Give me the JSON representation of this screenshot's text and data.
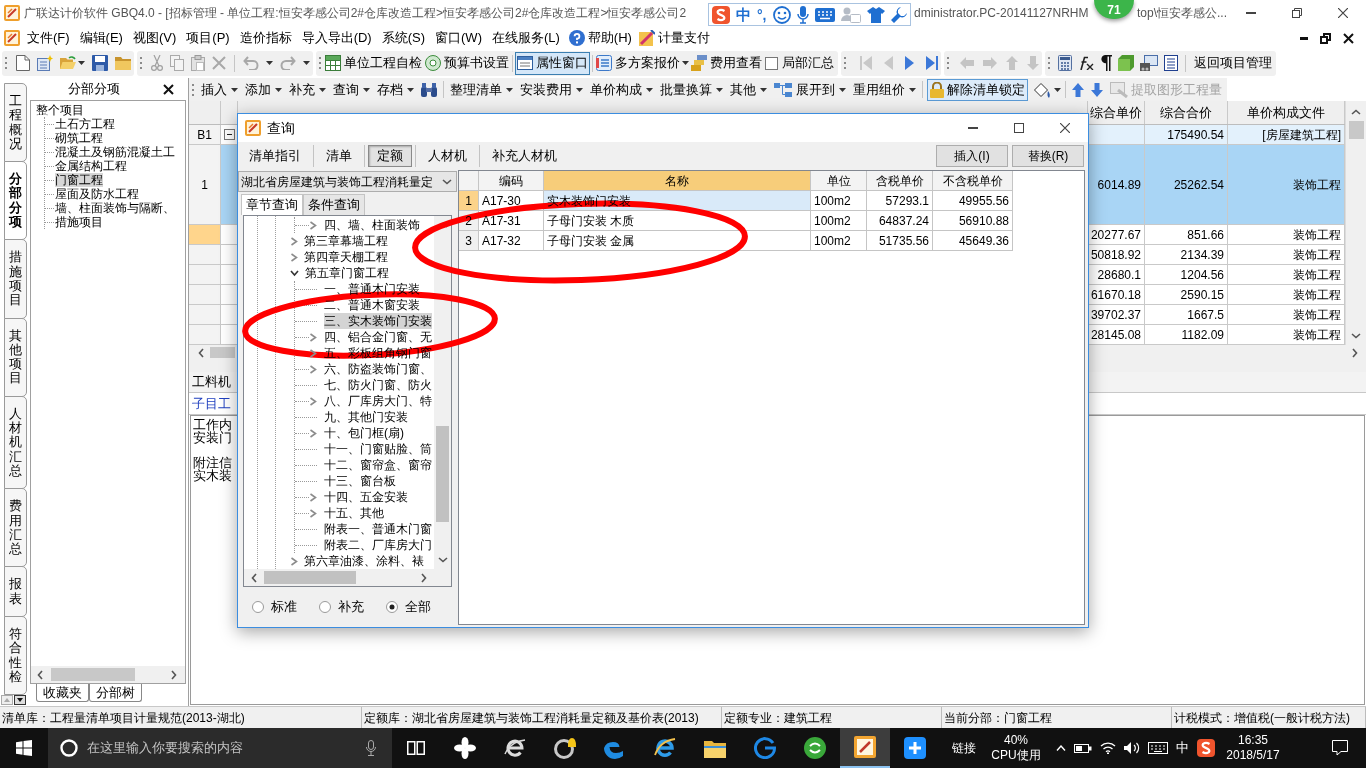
{
  "window": {
    "title": "广联达计价软件 GBQ4.0 - [招标管理 - 单位工程:恒安孝感公司2#仓库改造工程>恒安孝感公司2#仓库改造工程>恒安孝感公司2",
    "title_part_2": "dministrator.PC-20141127NRHM",
    "title_part_3": "top\\恒安孝感公..."
  },
  "ime_toolbar": {
    "mode": "中",
    "punctuation": "°,"
  },
  "floating_ball": {
    "value": "71"
  },
  "menu": {
    "items": [
      "文件(F)",
      "编辑(E)",
      "视图(V)",
      "项目(P)",
      "造价指标",
      "导入导出(D)",
      "系统(S)",
      "窗口(W)",
      "在线服务(L)"
    ],
    "help": "帮助(H)",
    "payment": "计量支付"
  },
  "toolbar": {
    "self_check": "单位工程自检",
    "budget_settings": "预算书设置",
    "property_window": {
      "label": "属性窗口",
      "pressed": true
    },
    "multi_quote": "多方案报价",
    "cost_view": "费用查看",
    "partial_summary": {
      "label": "局部汇总",
      "checked": false
    },
    "return_to_project": "返回项目管理"
  },
  "side_tabs": [
    {
      "label": "工程概况",
      "selected": false
    },
    {
      "label": "分部分项",
      "selected": true
    },
    {
      "label": "措施项目",
      "selected": false
    },
    {
      "label": "其他项目",
      "selected": false
    },
    {
      "label": "人材机汇总",
      "selected": false
    },
    {
      "label": "费用汇总",
      "selected": false
    },
    {
      "label": "报表",
      "selected": false
    },
    {
      "label": "符合性检",
      "selected": false
    }
  ],
  "division_panel": {
    "title": "分部分项",
    "tree": {
      "label": "整个项目",
      "selected": false,
      "children": [
        {
          "label": "土石方工程",
          "selected": false
        },
        {
          "label": "砌筑工程",
          "selected": false
        },
        {
          "label": "混凝土及钢筋混凝土工",
          "selected": false
        },
        {
          "label": "金属结构工程",
          "selected": false
        },
        {
          "label": "门窗工程",
          "selected": true
        },
        {
          "label": "屋面及防水工程",
          "selected": false
        },
        {
          "label": "墙、柱面装饰与隔断、",
          "selected": false
        },
        {
          "label": "措施项目",
          "selected": false
        }
      ]
    },
    "bottom_tabs": [
      "收藏夹",
      "分部树"
    ]
  },
  "edit_toolbar": {
    "menus": [
      {
        "label": "插入",
        "kind": "menu"
      },
      {
        "label": "添加",
        "kind": "menu"
      },
      {
        "label": "补充",
        "kind": "menu"
      },
      {
        "label": "查询",
        "kind": "menu"
      },
      {
        "label": "存档",
        "kind": "menu"
      }
    ],
    "tools": [
      {
        "label": "整理清单",
        "kind": "menu"
      },
      {
        "label": "安装费用",
        "kind": "menu"
      },
      {
        "label": "单价构成",
        "kind": "menu"
      },
      {
        "label": "批量换算",
        "kind": "menu"
      },
      {
        "label": "其他",
        "kind": "menu"
      },
      {
        "label": "展开到",
        "kind": "icon_menu"
      },
      {
        "label": "重用组价",
        "kind": "menu"
      }
    ],
    "unlock": {
      "label": "解除清单锁定",
      "pressed": true
    },
    "extract": {
      "label": "提取图形工程量",
      "disabled": true
    }
  },
  "grid": {
    "columns": [
      "综合单价",
      "综合合价",
      "单价构成文件"
    ],
    "rows": [
      {
        "kind": "section",
        "number": "B1",
        "expanded": true,
        "selected": false,
        "focused": false,
        "total": "175490.54",
        "price_file": "[房屋建筑工程]"
      },
      {
        "kind": "item",
        "number": "1",
        "selected": true,
        "focused": false,
        "unit_price": "6014.89",
        "total": "25262.54",
        "price_file": "装饰工程"
      },
      {
        "kind": "sub",
        "selected": false,
        "focused": true,
        "unit_price": "20277.67",
        "total": "851.66",
        "price_file": "装饰工程"
      },
      {
        "kind": "sub",
        "selected": false,
        "focused": false,
        "unit_price": "50818.92",
        "total": "2134.39",
        "price_file": "装饰工程"
      },
      {
        "kind": "sub",
        "selected": false,
        "focused": false,
        "unit_price": "28680.1",
        "total": "1204.56",
        "price_file": "装饰工程"
      },
      {
        "kind": "sub",
        "selected": false,
        "focused": false,
        "unit_price": "61670.18",
        "total": "2590.15",
        "price_file": "装饰工程"
      },
      {
        "kind": "sub",
        "selected": false,
        "focused": false,
        "unit_price": "39702.37",
        "total": "1667.5",
        "price_file": "装饰工程"
      },
      {
        "kind": "sub",
        "selected": false,
        "focused": false,
        "unit_price": "28145.08",
        "total": "1182.09",
        "price_file": "装饰工程"
      }
    ]
  },
  "lower_panel": {
    "tab": "工料机",
    "subtab": "子目工",
    "sections": [
      {
        "heading": "工作内",
        "text": "安装门"
      },
      {
        "heading": "附注信",
        "text": "实木装"
      }
    ]
  },
  "dialog": {
    "title": "查询",
    "tabs": [
      {
        "label": "清单指引",
        "selected": false
      },
      {
        "label": "清单",
        "selected": false
      },
      {
        "label": "定额",
        "selected": true
      },
      {
        "label": "人材机",
        "selected": false
      },
      {
        "label": "补充人材机",
        "selected": false
      }
    ],
    "buttons": [
      "插入(I)",
      "替换(R)"
    ],
    "library": "湖北省房屋建筑与装饰工程消耗量定",
    "search_tabs": [
      {
        "label": "章节查询",
        "selected": true
      },
      {
        "label": "条件查询",
        "selected": false
      }
    ],
    "tree": [
      {
        "children": [
          {
            "label": "四、墙、柱面装饰",
            "kind": "branch",
            "expanded": false,
            "selected": false
          }
        ]
      },
      {
        "label": "第三章幕墙工程",
        "kind": "branch",
        "expanded": false,
        "selected": false
      },
      {
        "label": "第四章天棚工程",
        "kind": "branch",
        "expanded": false,
        "selected": false
      },
      {
        "label": "第五章门窗工程",
        "kind": "branch",
        "expanded": true,
        "selected": false,
        "children": [
          {
            "label": "一、普通木门安装",
            "kind": "leaf",
            "selected": false
          },
          {
            "label": "二、普通木窗安装",
            "kind": "leaf",
            "selected": false
          },
          {
            "label": "三、实木装饰门安装",
            "kind": "leaf",
            "selected": true
          },
          {
            "label": "四、铝合金门窗、无",
            "kind": "branch",
            "expanded": false,
            "selected": false
          },
          {
            "label": "五、彩板组角钢门窗",
            "kind": "branch",
            "expanded": false,
            "selected": false
          },
          {
            "label": "六、防盗装饰门窗、",
            "kind": "branch",
            "expanded": false,
            "selected": false
          },
          {
            "label": "七、防火门窗、防火",
            "kind": "leaf",
            "selected": false
          },
          {
            "label": "八、厂库房大门、特",
            "kind": "branch",
            "expanded": false,
            "selected": false
          },
          {
            "label": "九、其他门安装",
            "kind": "leaf",
            "selected": false
          },
          {
            "label": "十、包门框(扇)",
            "kind": "branch",
            "expanded": false,
            "selected": false
          },
          {
            "label": "十一、门窗贴脸、筒",
            "kind": "leaf",
            "selected": false
          },
          {
            "label": "十二、窗帘盒、窗帘",
            "kind": "leaf",
            "selected": false
          },
          {
            "label": "十三、窗台板",
            "kind": "leaf",
            "selected": false
          },
          {
            "label": "十四、五金安装",
            "kind": "branch",
            "expanded": false,
            "selected": false
          },
          {
            "label": "十五、其他",
            "kind": "branch",
            "expanded": false,
            "selected": false
          },
          {
            "label": "附表一、普通木门窗",
            "kind": "leaf",
            "selected": false
          },
          {
            "label": "附表二、厂库房大门",
            "kind": "leaf",
            "selected": false
          }
        ]
      },
      {
        "label": "第六章油漆、涂料、裱",
        "kind": "branch",
        "expanded": false,
        "selected": false
      }
    ],
    "filters": [
      {
        "label": "标准",
        "selected": false
      },
      {
        "label": "补充",
        "selected": false
      },
      {
        "label": "全部",
        "selected": true
      }
    ],
    "table": {
      "columns": [
        {
          "label": "编码",
          "selected": false
        },
        {
          "label": "名称",
          "selected": true
        },
        {
          "label": "单位",
          "selected": false
        },
        {
          "label": "含税单价",
          "selected": false
        },
        {
          "label": "不含税单价",
          "selected": false
        }
      ],
      "rows": [
        {
          "number": "1",
          "selected": true,
          "cells": [
            "A17-30",
            "实木装饰门安装",
            "100m2",
            "57293.1",
            "49955.56"
          ]
        },
        {
          "number": "2",
          "selected": false,
          "cells": [
            "A17-31",
            "子母门安装 木质",
            "100m2",
            "64837.24",
            "56910.88"
          ]
        },
        {
          "number": "3",
          "selected": false,
          "cells": [
            "A17-32",
            "子母门安装 金属",
            "100m2",
            "51735.56",
            "45649.36"
          ]
        }
      ]
    }
  },
  "annotations": [
    {
      "kind": "ellipse"
    },
    {
      "kind": "ellipse"
    }
  ],
  "status_bar": [
    "清单库：工程量清单项目计量规范(2013-湖北)",
    "定额库：湖北省房屋建筑与装饰工程消耗量定额及基价表(2013)",
    "定额专业：建筑工程",
    "当前分部：门窗工程",
    "计税模式：增值税(一般计税方法)"
  ],
  "taskbar": {
    "search_placeholder": "在这里输入你要搜索的内容",
    "apps": [
      {
        "selected": false
      },
      {
        "selected": false
      },
      {
        "selected": false
      },
      {
        "selected": false
      },
      {
        "selected": false
      },
      {
        "selected": false
      },
      {
        "selected": false
      },
      {
        "selected": false
      },
      {
        "selected": true
      },
      {
        "selected": false
      }
    ],
    "links": "链接",
    "cpu_value": "40%",
    "cpu_label": "CPU使用",
    "input_mode": "中",
    "time": "16:35",
    "date": "2018/5/17"
  }
}
